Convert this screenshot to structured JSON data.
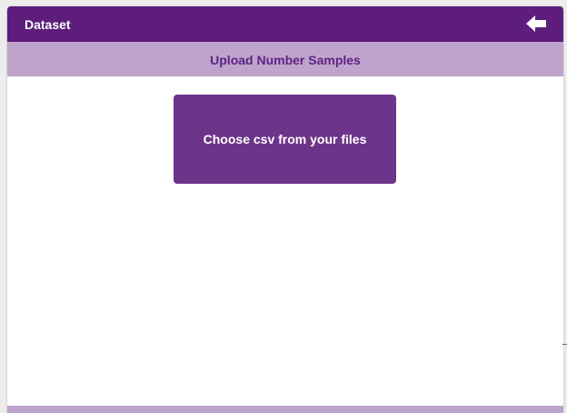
{
  "header": {
    "title": "Dataset",
    "back_icon": "arrow-left-icon"
  },
  "subheader": {
    "title": "Upload Number Samples"
  },
  "upload": {
    "button_label": "Choose csv from your files"
  },
  "colors": {
    "header_bg": "#5e1d7c",
    "subheader_bg": "#bea4cc",
    "subheader_text": "#5e2383",
    "button_bg": "#6d348a"
  }
}
